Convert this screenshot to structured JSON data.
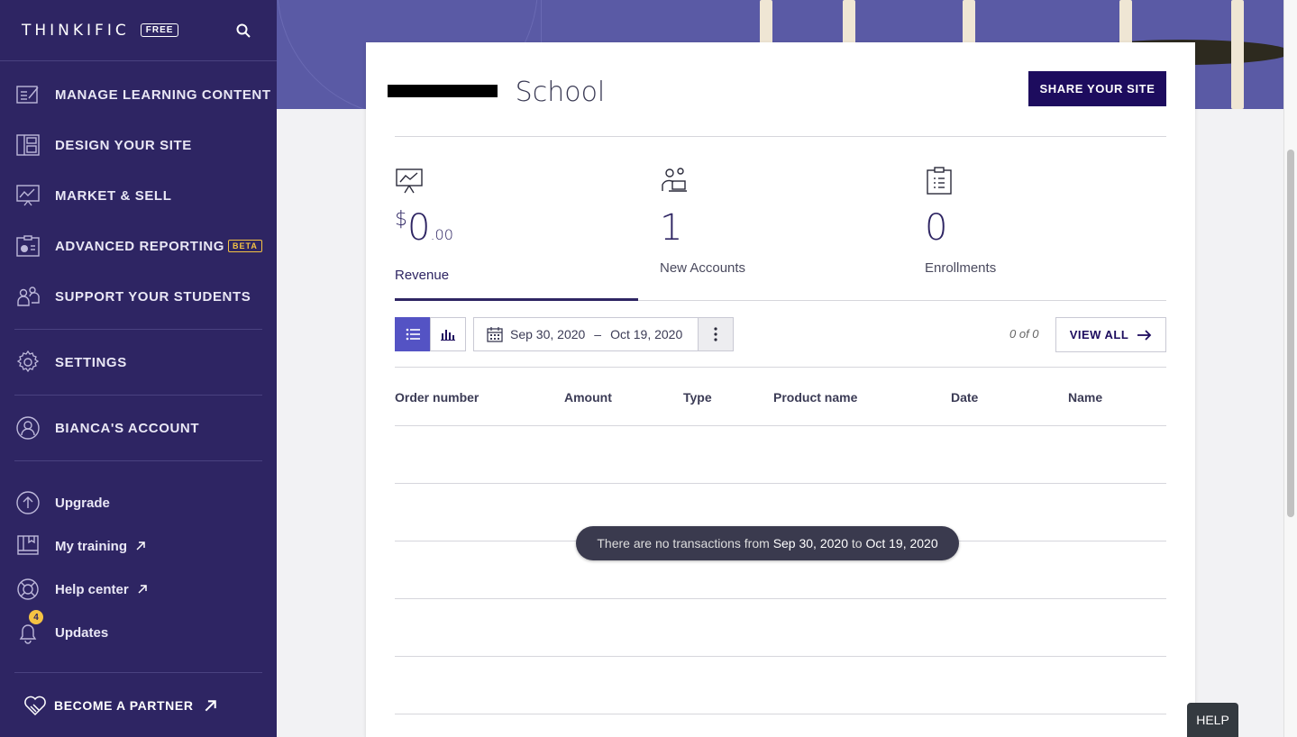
{
  "brand": {
    "name": "THINKIFIC",
    "plan": "FREE"
  },
  "sidebar": {
    "main_items": [
      {
        "label": "MANAGE LEARNING CONTENT",
        "icon": "edit-list-icon"
      },
      {
        "label": "DESIGN YOUR SITE",
        "icon": "layout-icon"
      },
      {
        "label": "MARKET & SELL",
        "icon": "chart-icon"
      },
      {
        "label": "ADVANCED REPORTING",
        "icon": "report-icon",
        "badge": "BETA"
      },
      {
        "label": "SUPPORT YOUR STUDENTS",
        "icon": "students-icon"
      }
    ],
    "settings": "SETTINGS",
    "account": "BIANCA'S ACCOUNT",
    "links": [
      {
        "label": "Upgrade",
        "icon": "upgrade-icon"
      },
      {
        "label": "My training",
        "icon": "book-icon"
      },
      {
        "label": "Help center",
        "icon": "lifebuoy-icon"
      },
      {
        "label": "Updates",
        "icon": "bell-icon",
        "count": "4"
      }
    ],
    "partner": "BECOME A PARTNER"
  },
  "header": {
    "school_name": "School",
    "share_button": "SHARE YOUR SITE"
  },
  "stats": [
    {
      "currency": "$",
      "value": "0",
      "cents": ".00",
      "label": "Revenue"
    },
    {
      "value": "1",
      "label": "New Accounts"
    },
    {
      "value": "0",
      "label": "Enrollments"
    }
  ],
  "toolbar": {
    "date_start": "Sep 30, 2020",
    "date_sep": "–",
    "date_end": "Oct 19, 2020",
    "pager": "0 of 0",
    "view_all": "VIEW ALL"
  },
  "table": {
    "columns": [
      "Order number",
      "Amount",
      "Type",
      "Product name",
      "Date",
      "Name"
    ]
  },
  "empty_message": {
    "prefix": "There are no transactions from",
    "start": "Sep 30, 2020",
    "mid": "to",
    "end": "Oct 19, 2020"
  },
  "help": "HELP"
}
